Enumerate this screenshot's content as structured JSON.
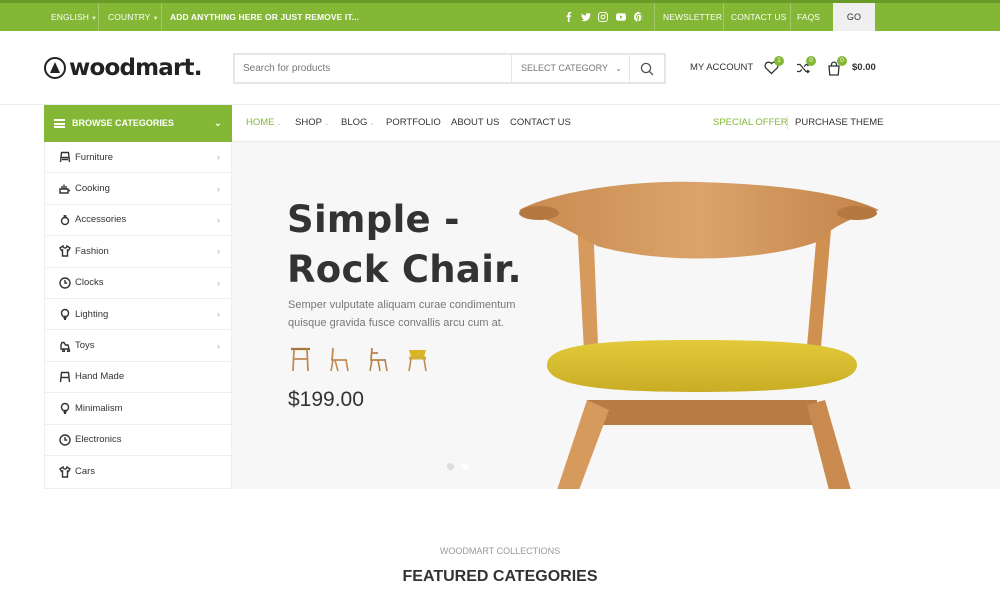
{
  "topbar": {
    "language": "ENGLISH",
    "country": "COUNTRY",
    "promo": "ADD ANYTHING HERE OR JUST REMOVE IT...",
    "social": [
      "facebook-icon",
      "twitter-icon",
      "instagram-icon",
      "youtube-icon",
      "pinterest-icon"
    ],
    "links": [
      "NEWSLETTER",
      "CONTACT US",
      "FAQS"
    ],
    "go_label": "GO"
  },
  "header": {
    "logo": "woodmart.",
    "search_placeholder": "Search for products",
    "select_category": "SELECT CATEGORY",
    "my_account": "MY ACCOUNT",
    "wishlist_count": "1",
    "compare_count": "0",
    "cart_count": "0",
    "cart_total": "$0.00"
  },
  "nav": {
    "browse_label": "BROWSE CATEGORIES",
    "items": [
      "HOME",
      "SHOP",
      "BLOG",
      "PORTFOLIO",
      "ABOUT US",
      "CONTACT US"
    ],
    "special_offer": "SPECIAL OFFER",
    "purchase_theme": "PURCHASE THEME"
  },
  "categories": [
    {
      "label": "Furniture",
      "icon": "chair-icon",
      "has_sub": true
    },
    {
      "label": "Cooking",
      "icon": "cooking-icon",
      "has_sub": true
    },
    {
      "label": "Accessories",
      "icon": "accessories-icon",
      "has_sub": true
    },
    {
      "label": "Fashion",
      "icon": "fashion-icon",
      "has_sub": true
    },
    {
      "label": "Clocks",
      "icon": "clock-icon",
      "has_sub": true
    },
    {
      "label": "Lighting",
      "icon": "lightbulb-icon",
      "has_sub": true
    },
    {
      "label": "Toys",
      "icon": "toy-icon",
      "has_sub": true
    },
    {
      "label": "Hand Made",
      "icon": "handmade-icon",
      "has_sub": false
    },
    {
      "label": "Minimalism",
      "icon": "minimalism-icon",
      "has_sub": false
    },
    {
      "label": "Electronics",
      "icon": "electronics-icon",
      "has_sub": false
    },
    {
      "label": "Cars",
      "icon": "car-icon",
      "has_sub": false
    }
  ],
  "hero": {
    "title_line1": "Simple -",
    "title_line2": "Rock Chair.",
    "description": "Semper vulputate aliquam curae condimentum quisque gravida fusce convallis arcu cum at.",
    "price": "$199.00",
    "slides": 2,
    "active_slide": 2
  },
  "featured": {
    "subtitle": "WOODMART COLLECTIONS",
    "title": "FEATURED CATEGORIES"
  },
  "colors": {
    "accent": "#83b735",
    "text": "#333333",
    "hero_bg": "#f7f7f7",
    "chair_wood": "#c8874a",
    "chair_seat": "#d9c02a"
  }
}
